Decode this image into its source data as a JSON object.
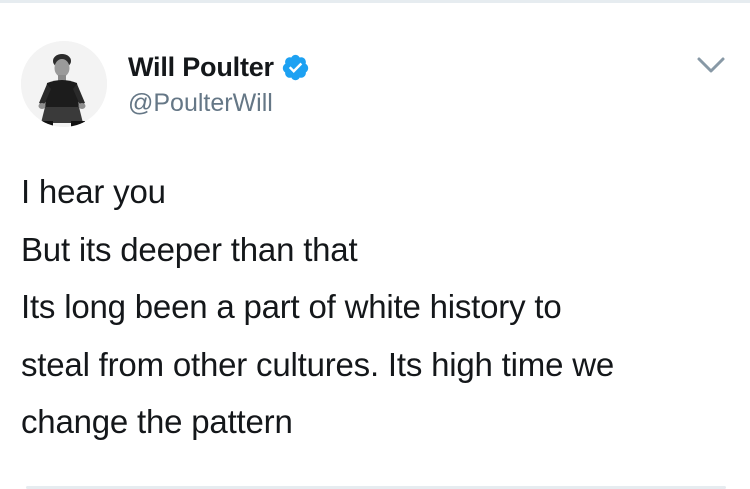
{
  "tweet": {
    "author": {
      "display_name": "Will Poulter",
      "handle": "@PoulterWill",
      "verified": true,
      "avatar_icon": "profile-photo"
    },
    "text_lines": [
      "I hear you",
      "But its deeper than that",
      "Its long been a part of white history to",
      "steal from other cultures. Its high time we",
      "change the pattern"
    ],
    "menu_icon": "chevron-down-icon"
  },
  "colors": {
    "verified_badge": "#1da1f2",
    "text_primary": "#14171a",
    "text_secondary": "#657786",
    "divider": "#e6ecf0",
    "chevron": "#8899a6"
  }
}
